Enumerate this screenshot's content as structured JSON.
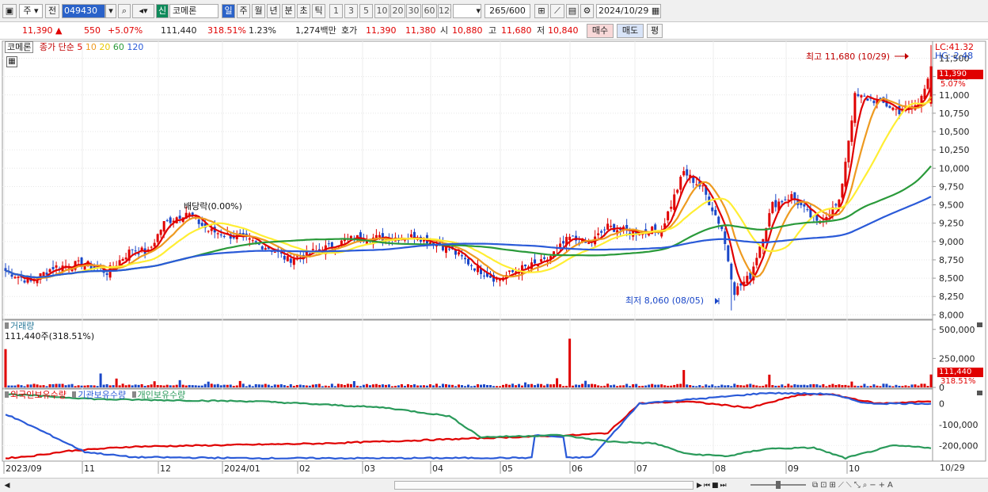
{
  "toolbar": {
    "period_type": "주",
    "prev_label": "전",
    "code": "049430",
    "credit_label": "신",
    "name": "코메론",
    "period_tabs": [
      "일",
      "주",
      "월",
      "년",
      "분",
      "초",
      "틱"
    ],
    "active_tab": "일",
    "intervals": [
      "1",
      "3",
      "5",
      "10",
      "20",
      "30",
      "60",
      "120"
    ],
    "count": "265",
    "count_total": "/600",
    "date": "2024/10/29"
  },
  "quote": {
    "price": "11,390",
    "change": "550",
    "change_pct": "+5.07%",
    "volume": "111,440",
    "volume_pct": "318.51%",
    "turnover_pct": "1.23%",
    "amount": "1,274백만",
    "ask_label": "호가",
    "ask": "11,390",
    "bid": "11,380",
    "open_label": "시",
    "open": "10,880",
    "high_label": "고",
    "high": "11,680",
    "low_label": "저",
    "low": "10,840",
    "buy_label": "매수",
    "sell_label": "매도",
    "eval_label": "평"
  },
  "chart": {
    "title": "코메론",
    "ma_label": "종가 단순",
    "ma_periods": [
      "5",
      "10",
      "20",
      "60",
      "120"
    ],
    "ma_colors": [
      "#e00000",
      "#ee9a20",
      "#ffee33",
      "#2a9a3a",
      "#2a5ad8"
    ],
    "lc": "LC:41.32",
    "hc": "HC:-2.48",
    "cur_price_tag": "11,390",
    "cur_pct_tag": "5.07%",
    "high_note": "최고 11,680 (10/29)",
    "low_note": "최저 8,060 (08/05)",
    "dividend_note": "배당락(0.00%)",
    "volume_title": "거래량",
    "volume_now": "111,440주(318.51%)",
    "volume_tag": "111,440",
    "volume_pct_tag": "318.51%",
    "holders": [
      "외국인보유수량",
      "기관보유수량",
      "개인보유수량"
    ],
    "holder_colors": [
      "#e00000",
      "#2a5ad8",
      "#2a9a5a"
    ],
    "end_date": "10/29",
    "up_color": "#e00000",
    "down_color": "#1a47c8"
  },
  "chart_data": {
    "type": "candlestick",
    "x_labels": [
      "2023/09",
      "11",
      "12",
      "2024/01",
      "02",
      "03",
      "04",
      "05",
      "06",
      "07",
      "08",
      "09",
      "10"
    ],
    "price_ticks": [
      8000,
      8250,
      8500,
      8750,
      9000,
      9250,
      9500,
      9750,
      10000,
      10250,
      10500,
      10750,
      11000,
      11250,
      11500
    ],
    "price_range": [
      7950,
      11700
    ],
    "price_anchors": [
      [
        0,
        8600
      ],
      [
        8,
        8450
      ],
      [
        15,
        8650
      ],
      [
        25,
        8700
      ],
      [
        32,
        8580
      ],
      [
        40,
        8900
      ],
      [
        45,
        8850
      ],
      [
        50,
        9250
      ],
      [
        57,
        9400
      ],
      [
        64,
        9150
      ],
      [
        74,
        9050
      ],
      [
        84,
        8900
      ],
      [
        89,
        8750
      ],
      [
        98,
        8870
      ],
      [
        110,
        9050
      ],
      [
        120,
        9050
      ],
      [
        130,
        9070
      ],
      [
        140,
        8900
      ],
      [
        148,
        8650
      ],
      [
        155,
        8480
      ],
      [
        162,
        8620
      ],
      [
        170,
        8720
      ],
      [
        178,
        9050
      ],
      [
        184,
        8960
      ],
      [
        190,
        9200
      ],
      [
        198,
        9120
      ],
      [
        207,
        9170
      ],
      [
        214,
        9950
      ],
      [
        220,
        9720
      ],
      [
        226,
        9180
      ],
      [
        230,
        8320
      ],
      [
        235,
        8530
      ],
      [
        242,
        9500
      ],
      [
        248,
        9620
      ],
      [
        256,
        9250
      ],
      [
        263,
        9520
      ],
      [
        268,
        10980
      ],
      [
        275,
        10920
      ],
      [
        282,
        10780
      ],
      [
        288,
        10870
      ],
      [
        292,
        11390
      ]
    ],
    "volume_ticks": [
      0,
      250000,
      500000
    ],
    "volume_now": 111440,
    "holder_ticks": [
      0,
      -100000,
      -200000
    ],
    "holder_range": [
      -270000,
      50000
    ]
  }
}
